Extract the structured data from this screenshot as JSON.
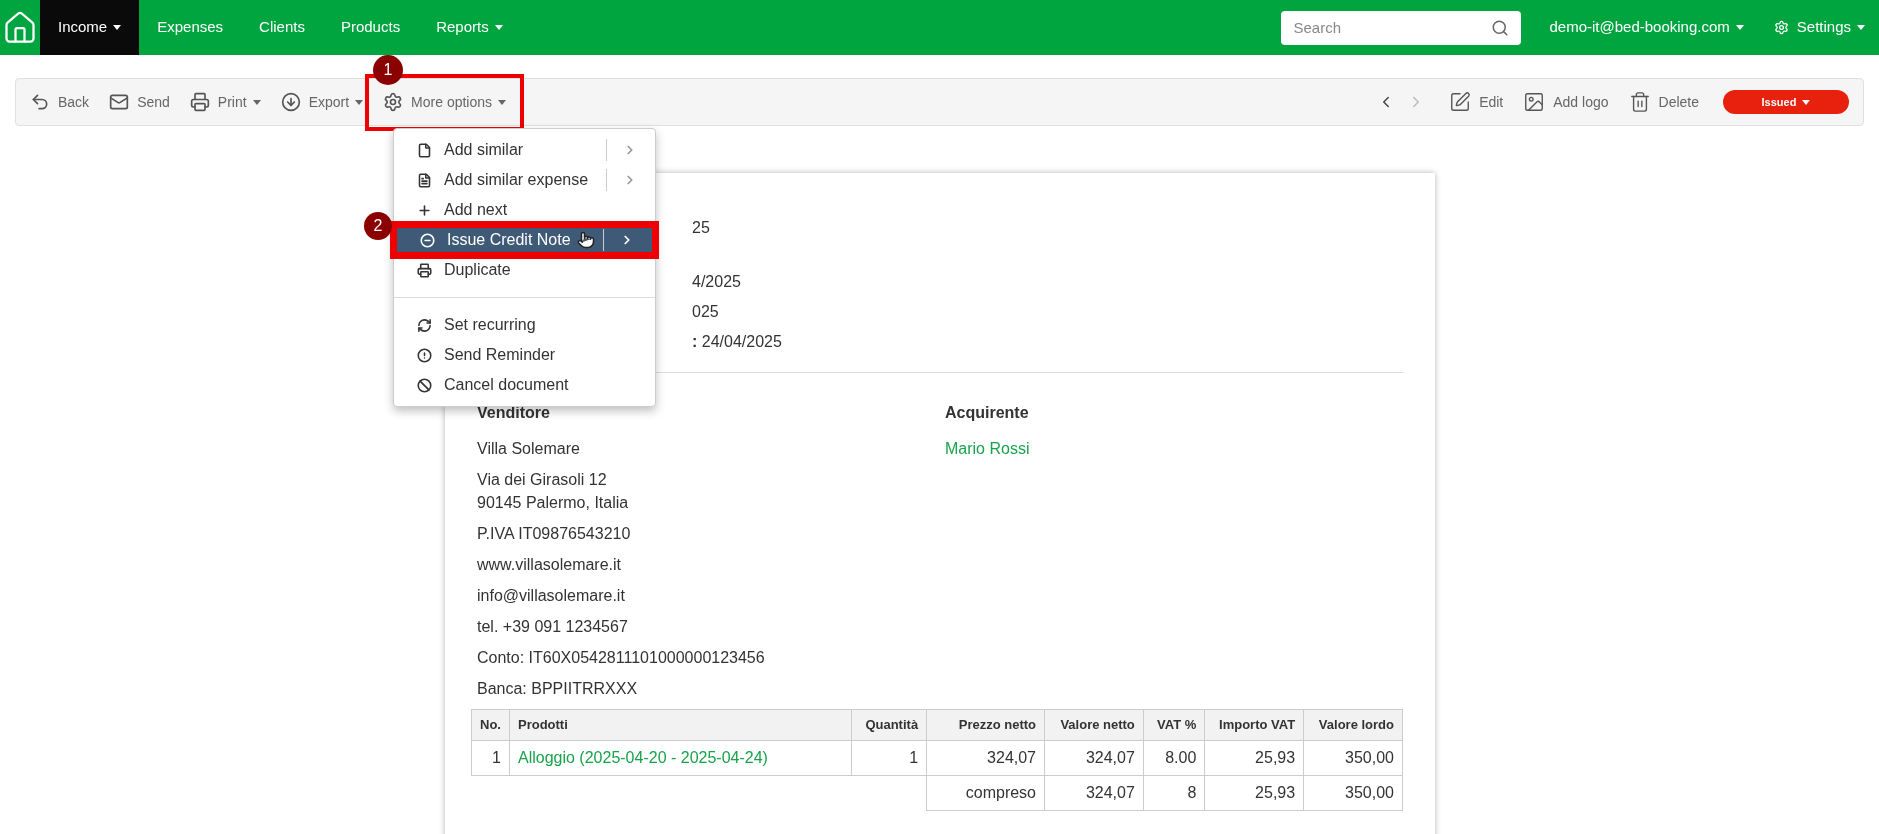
{
  "nav": {
    "items": [
      {
        "label": "Income",
        "selected": true,
        "dropdown": true
      },
      {
        "label": "Expenses",
        "selected": false,
        "dropdown": false
      },
      {
        "label": "Clients",
        "selected": false,
        "dropdown": false
      },
      {
        "label": "Products",
        "selected": false,
        "dropdown": false
      },
      {
        "label": "Reports",
        "selected": false,
        "dropdown": true
      }
    ],
    "search": {
      "placeholder": "Search"
    },
    "account": "demo-it@bed-booking.com",
    "settings": "Settings"
  },
  "toolbar": {
    "left": [
      {
        "label": "Back",
        "dropdown": false
      },
      {
        "label": "Send",
        "dropdown": false
      },
      {
        "label": "Print",
        "dropdown": true
      },
      {
        "label": "Export",
        "dropdown": true
      },
      {
        "label": "More options",
        "dropdown": true,
        "annotated": true
      }
    ],
    "right": [
      {
        "label": "Edit"
      },
      {
        "label": "Add logo"
      },
      {
        "label": "Delete"
      }
    ],
    "status": "Issued"
  },
  "menu": {
    "groups": [
      [
        {
          "label": "Add similar",
          "submenu": true,
          "selected": false
        },
        {
          "label": "Add similar expense",
          "submenu": true,
          "selected": false
        },
        {
          "label": "Add next",
          "submenu": false,
          "selected": false
        },
        {
          "label": "Issue Credit Note",
          "submenu": true,
          "selected": true,
          "annotated": true
        },
        {
          "label": "Duplicate",
          "submenu": false,
          "selected": false
        }
      ],
      [
        {
          "label": "Set recurring",
          "submenu": false,
          "selected": false
        },
        {
          "label": "Send Reminder",
          "submenu": false,
          "selected": false
        },
        {
          "label": "Cancel document",
          "submenu": false,
          "selected": false
        }
      ]
    ]
  },
  "annotations": [
    "1",
    "2"
  ],
  "document": {
    "header_lines": [
      "25",
      "4/2025",
      "025",
      "**:** 24/04/2025"
    ],
    "seller": {
      "title": "Venditore",
      "lines": [
        "Villa Solemare",
        "Via dei Girasoli 12\n90145 Palermo, Italia",
        "P.IVA IT09876543210",
        "www.villasolemare.it",
        "info@villasolemare.it",
        "tel. +39 091 1234567",
        "Conto: IT60X0542811101000000123456",
        "Banca: BPPIITRRXXX"
      ]
    },
    "buyer": {
      "title": "Acquirente",
      "name": "Mario Rossi"
    },
    "table": {
      "columns": [
        "No.",
        "Prodotti",
        "Quantità",
        "Prezzo netto",
        "Valore netto",
        "VAT %",
        "Importo VAT",
        "Valore lordo"
      ],
      "rows": [
        [
          "1",
          "Alloggio (2025-04-20 - 2025-04-24)",
          "1",
          "324,07",
          "324,07",
          "8.00",
          "25,93",
          "350,00"
        ]
      ],
      "summary": [
        "compreso",
        "324,07",
        "8",
        "25,93",
        "350,00"
      ]
    }
  }
}
